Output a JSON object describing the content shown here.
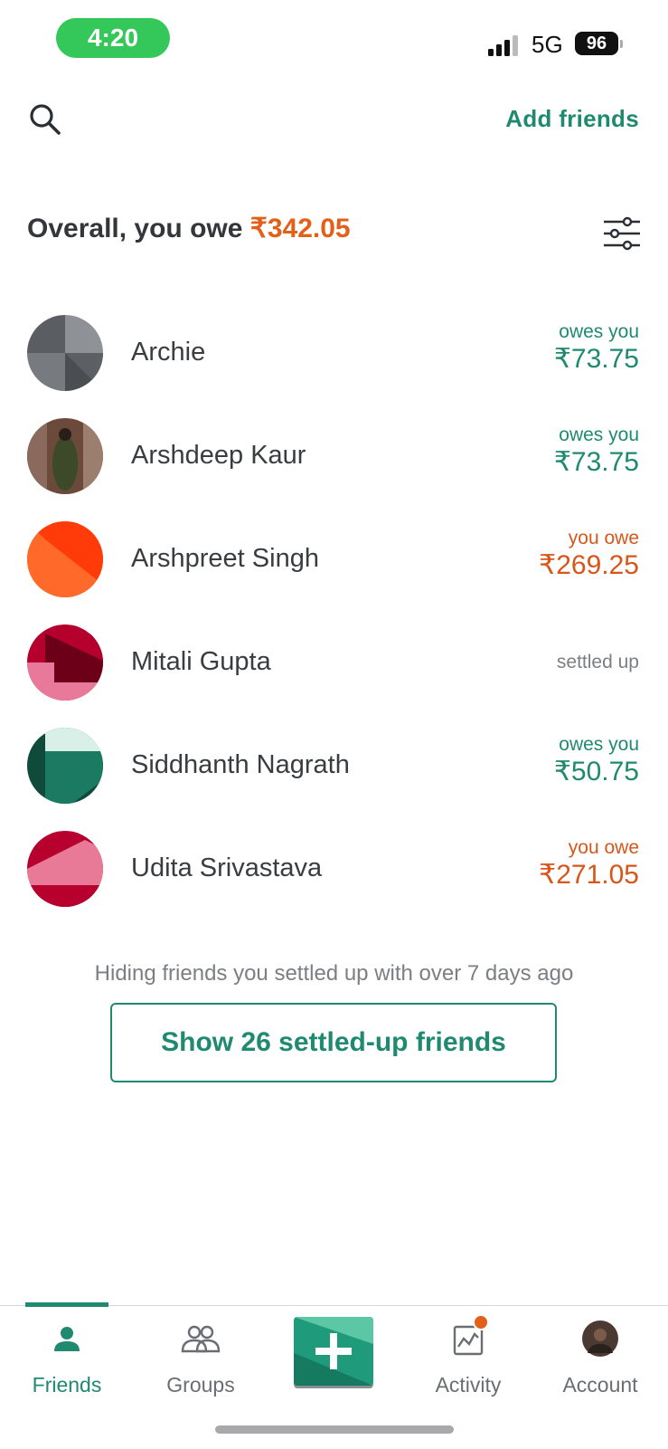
{
  "status_bar": {
    "time": "4:20",
    "network": "5G",
    "battery": "96"
  },
  "header": {
    "search_icon": "search-icon",
    "add_friends_label": "Add friends"
  },
  "summary": {
    "prefix": "Overall, you owe ",
    "amount": "₹342.05",
    "filter_icon": "sliders-icon"
  },
  "colors": {
    "brand_green": "#1f8a70",
    "owe_orange": "#d8561a"
  },
  "friends": [
    {
      "name": "Archie",
      "status": "owes you",
      "amount": "₹73.75",
      "tone": "green"
    },
    {
      "name": "Arshdeep Kaur",
      "status": "owes you",
      "amount": "₹73.75",
      "tone": "green"
    },
    {
      "name": "Arshpreet Singh",
      "status": "you owe",
      "amount": "₹269.25",
      "tone": "orange"
    },
    {
      "name": "Mitali Gupta",
      "status": "settled up",
      "amount": "",
      "tone": "settled"
    },
    {
      "name": "Siddhanth Nagrath",
      "status": "owes you",
      "amount": "₹50.75",
      "tone": "green"
    },
    {
      "name": "Udita Srivastava",
      "status": "you owe",
      "amount": "₹271.05",
      "tone": "orange"
    }
  ],
  "hiding_note": "Hiding friends you settled up with over 7 days ago",
  "show_settled_label": "Show 26 settled-up friends",
  "tabs": [
    {
      "label": "Friends",
      "icon": "person-icon",
      "active": true
    },
    {
      "label": "Groups",
      "icon": "group-icon",
      "active": false
    },
    {
      "label": "",
      "icon": "plus-icon",
      "active": false
    },
    {
      "label": "Activity",
      "icon": "activity-icon",
      "active": false
    },
    {
      "label": "Account",
      "icon": "account-avatar",
      "active": false
    }
  ]
}
